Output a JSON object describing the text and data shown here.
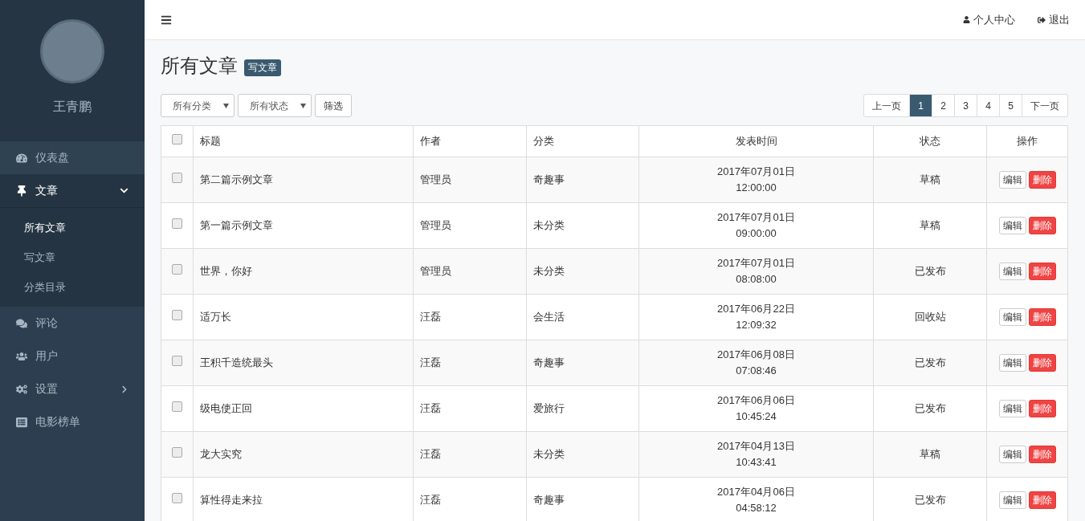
{
  "sidebar": {
    "user_name": "王青鹏",
    "items": [
      {
        "label": "仪表盘",
        "selected": false
      },
      {
        "label": "文章",
        "selected": true,
        "expanded": true,
        "children": [
          {
            "label": "所有文章",
            "selected": true
          },
          {
            "label": "写文章",
            "selected": false
          },
          {
            "label": "分类目录",
            "selected": false
          }
        ]
      },
      {
        "label": "评论",
        "selected": false
      },
      {
        "label": "用户",
        "selected": false
      },
      {
        "label": "设置",
        "selected": false,
        "expanded": false
      },
      {
        "label": "电影榜单",
        "selected": false
      }
    ]
  },
  "topbar": {
    "links": [
      "个人中心",
      "退出"
    ]
  },
  "page": {
    "title": "所有文章",
    "new_button": "写文章"
  },
  "filters": {
    "selects": [
      "所有分类",
      "所有状态"
    ],
    "button": "筛选"
  },
  "pagination": {
    "prev": "上一页",
    "pages": [
      {
        "label": "1",
        "selected": true
      },
      {
        "label": "2",
        "selected": false
      },
      {
        "label": "3",
        "selected": false
      },
      {
        "label": "4",
        "selected": false
      },
      {
        "label": "5",
        "selected": false
      }
    ],
    "next": "下一页"
  },
  "table": {
    "select_all_checked": false,
    "columns": [
      "标题",
      "作者",
      "分类",
      "发表时间",
      "状态",
      "操作"
    ],
    "rows": [
      {
        "checked": false,
        "title": "第二篇示例文章",
        "author": "管理员",
        "category": "奇趣事",
        "date": "2017年07月01日",
        "time": "12:00:00",
        "status": "草稿",
        "actions": [
          "编辑",
          "删除"
        ]
      },
      {
        "checked": false,
        "title": "第一篇示例文章",
        "author": "管理员",
        "category": "未分类",
        "date": "2017年07月01日",
        "time": "09:00:00",
        "status": "草稿",
        "actions": [
          "编辑",
          "删除"
        ]
      },
      {
        "checked": false,
        "title": "世界，你好",
        "author": "管理员",
        "category": "未分类",
        "date": "2017年07月01日",
        "time": "08:08:00",
        "status": "已发布",
        "actions": [
          "编辑",
          "删除"
        ]
      },
      {
        "checked": false,
        "title": "适万长",
        "author": "汪磊",
        "category": "会生活",
        "date": "2017年06月22日",
        "time": "12:09:32",
        "status": "回收站",
        "actions": [
          "编辑",
          "删除"
        ]
      },
      {
        "checked": false,
        "title": "王积千造统最头",
        "author": "汪磊",
        "category": "奇趣事",
        "date": "2017年06月08日",
        "time": "07:08:46",
        "status": "已发布",
        "actions": [
          "编辑",
          "删除"
        ]
      },
      {
        "checked": false,
        "title": "级电使正回",
        "author": "汪磊",
        "category": "爱旅行",
        "date": "2017年06月06日",
        "time": "10:45:24",
        "status": "已发布",
        "actions": [
          "编辑",
          "删除"
        ]
      },
      {
        "checked": false,
        "title": "龙大实究",
        "author": "汪磊",
        "category": "未分类",
        "date": "2017年04月13日",
        "time": "10:43:41",
        "status": "草稿",
        "actions": [
          "编辑",
          "删除"
        ]
      },
      {
        "checked": false,
        "title": "算性得走来拉",
        "author": "汪磊",
        "category": "奇趣事",
        "date": "2017年04月06日",
        "time": "04:58:12",
        "status": "已发布",
        "actions": [
          "编辑",
          "删除"
        ]
      }
    ]
  }
}
